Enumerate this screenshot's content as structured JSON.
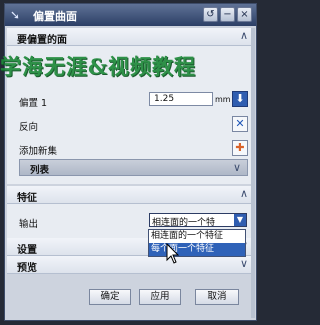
{
  "window": {
    "title": "偏置曲面",
    "title_icon": "offset-arrow-icon",
    "buttons": {
      "reset": "↺",
      "minimize": "−",
      "close": "×"
    }
  },
  "watermark": "学海无涯&视频教程",
  "faces_section": {
    "title": "要偏置的面",
    "chevron": "∧"
  },
  "offset": {
    "label": "偏置 1",
    "value": "1.25",
    "unit": "mm"
  },
  "reverse": {
    "label": "反向"
  },
  "add_new_set": {
    "label": "添加新集"
  },
  "list": {
    "label": "列表",
    "chevron": "∨"
  },
  "features_section": {
    "title": "特征",
    "chevron": "∧"
  },
  "output": {
    "label": "输出",
    "selected": "相连面的一个特",
    "options": [
      "相连面的一个特征",
      "每个面一个特征"
    ],
    "highlighted": "每个面一个特征"
  },
  "settings_section": {
    "title": "设置",
    "chevron": "∨"
  },
  "preview_section": {
    "title": "预览",
    "chevron": "∨"
  },
  "footer": {
    "ok": "确定",
    "apply": "应用",
    "cancel": "取消"
  }
}
